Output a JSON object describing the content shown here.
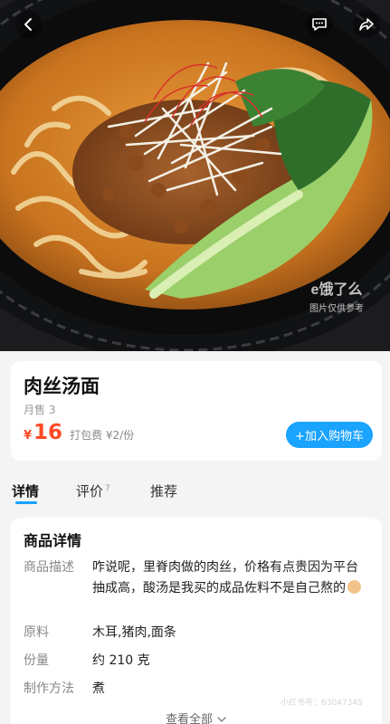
{
  "hero": {
    "watermark_logo": "e饿了么",
    "watermark_caption": "图片仅供参考"
  },
  "icons": {
    "back": "chevron-left-icon",
    "chat": "message-icon",
    "share": "share-icon",
    "emoji": "face-emoji-icon",
    "view_all_chevron": "chevron-down-icon"
  },
  "product": {
    "name": "肉丝汤面",
    "monthly_sales": "月售 3",
    "currency": "¥",
    "price": "16",
    "packing_fee": "打包费 ¥2/份",
    "add_to_cart": "+加入购物车"
  },
  "tabs": [
    {
      "label": "详情",
      "count": ""
    },
    {
      "label": "评价",
      "count": "7"
    },
    {
      "label": "推荐",
      "count": ""
    }
  ],
  "details": {
    "title": "商品详情",
    "rows": [
      {
        "label": "商品描述",
        "value": "咋说呢，里脊肉做的肉丝，价格有点贵因为平台抽成高，酸汤是我买的成品佐料不是自己熬的"
      },
      {
        "label": "原料",
        "value": "木耳,猪肉,面条"
      },
      {
        "label": "份量",
        "value": "约 210 克"
      },
      {
        "label": "制作方法",
        "value": "煮"
      }
    ],
    "view_all": "查看全部",
    "license": "小红书号：63047345"
  },
  "colors": {
    "accent": "#1aa3ff",
    "price": "#ff4a26",
    "background": "#f4f4f4"
  }
}
